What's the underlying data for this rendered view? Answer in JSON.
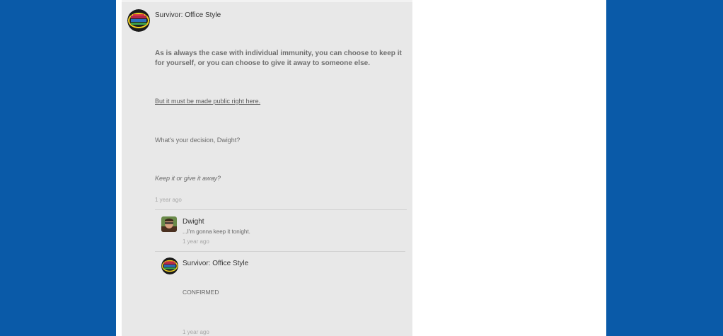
{
  "thread": {
    "post": {
      "author": "Survivor: Office Style",
      "paragraph_1": "As is always the case with individual immunity, you can choose to keep it for yourself, or you can choose to give it away to someone else.",
      "paragraph_2": "But it must be made public right here.",
      "paragraph_3": "What's your decision, Dwight?",
      "paragraph_4": "Keep it or give it away?",
      "time": "1 year ago"
    },
    "replies": [
      {
        "author": "Dwight",
        "text": "...I'm gonna keep it tonight.",
        "time": "1 year ago"
      },
      {
        "author": "Survivor: Office Style",
        "text": "CONFIRMED",
        "time": "1 year ago"
      }
    ]
  },
  "colors": {
    "background": "#0a5aa8",
    "page": "#ffffff",
    "post_panel": "#e8e8e8"
  },
  "icons": {
    "survivor_avatar": "survivor-logo-icon",
    "dwight_avatar": "dwight-photo-icon"
  }
}
